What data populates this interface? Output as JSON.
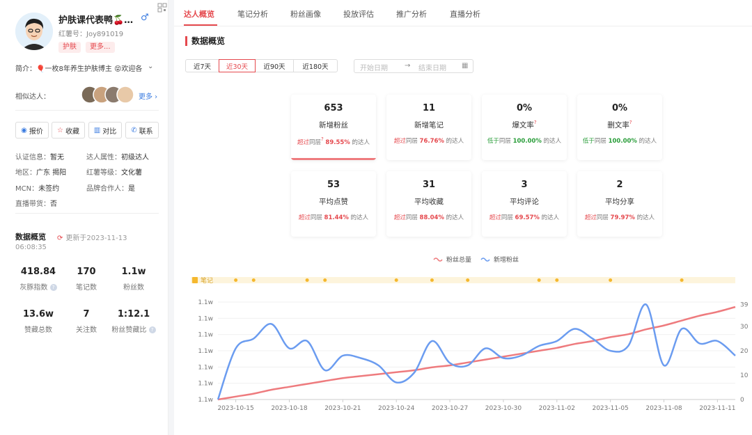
{
  "profile": {
    "name": "护肤课代表鸭🍒…",
    "gender_symbol": "♂",
    "red_id": "红薯号：Joy891019",
    "tags": [
      "护肤",
      "更多..."
    ],
    "intro": "简介：🎈一枚8年养生护肤博主 😝欢迎各",
    "similar_label": "相似达人：",
    "more_label": "更多",
    "actions": [
      "报价",
      "收藏",
      "对比",
      "联系"
    ],
    "info": {
      "cert_k": "认证信息：",
      "cert_v": "暂无",
      "attr_k": "达人属性：",
      "attr_v": "初级达人",
      "region_k": "地区：",
      "region_v": "广东 揭阳",
      "level_k": "红薯等级：",
      "level_v": "文化薯",
      "mcn_k": "MCN：",
      "mcn_v": "未签约",
      "brand_k": "品牌合作人：",
      "brand_v": "是",
      "live_k": "直播带货：",
      "live_v": "否"
    },
    "overview_title": "数据概览",
    "updated_line1": "更新于2023-11-13",
    "updated_line2": "06:08:35",
    "stats": [
      {
        "value": "418.84",
        "label": "灰豚指数"
      },
      {
        "value": "170",
        "label": "笔记数"
      },
      {
        "value": "1.1w",
        "label": "粉丝数"
      },
      {
        "value": "13.6w",
        "label": "赞藏总数"
      },
      {
        "value": "7",
        "label": "关注数"
      },
      {
        "value": "1:12.1",
        "label": "粉丝赞藏比"
      }
    ]
  },
  "tabs": [
    "达人概览",
    "笔记分析",
    "粉丝画像",
    "投放评估",
    "推广分析",
    "直播分析"
  ],
  "section_title": "数据概览",
  "ranges": [
    "近7天",
    "近30天",
    "近90天",
    "近180天"
  ],
  "selected_range": "近30天",
  "date_range": {
    "start_placeholder": "开始日期",
    "arrow": "→",
    "end_placeholder": "结束日期"
  },
  "cards": [
    {
      "value": "653",
      "label": "新增粉丝",
      "pre": "超过",
      "mid": "同层",
      "pct": "89.55%",
      "post": "的达人",
      "tone": "red",
      "help": true
    },
    {
      "value": "11",
      "label": "新增笔记",
      "pre": "超过",
      "mid": "同层",
      "pct": "76.76%",
      "post": "的达人",
      "tone": "red",
      "help": false
    },
    {
      "value": "0%",
      "label": "爆文率",
      "pre": "低于",
      "mid": "同层",
      "pct": "100.00%",
      "post": "的达人",
      "tone": "green",
      "help": true
    },
    {
      "value": "0%",
      "label": "删文率",
      "pre": "低于",
      "mid": "同层",
      "pct": "100.00%",
      "post": "的达人",
      "tone": "green",
      "help": true
    },
    {
      "value": "53",
      "label": "平均点赞",
      "pre": "超过",
      "mid": "同层",
      "pct": "81.44%",
      "post": "的达人",
      "tone": "red",
      "help": false
    },
    {
      "value": "31",
      "label": "平均收藏",
      "pre": "超过",
      "mid": "同层",
      "pct": "88.04%",
      "post": "的达人",
      "tone": "red",
      "help": false
    },
    {
      "value": "3",
      "label": "平均评论",
      "pre": "超过",
      "mid": "同层",
      "pct": "69.57%",
      "post": "的达人",
      "tone": "red",
      "help": false
    },
    {
      "value": "2",
      "label": "平均分享",
      "pre": "超过",
      "mid": "同层",
      "pct": "79.97%",
      "post": "的达人",
      "tone": "red",
      "help": false
    }
  ],
  "legend": {
    "total": "粉丝总量",
    "new": "新增粉丝"
  },
  "colors": {
    "accent": "#e5484d",
    "total_line": "#ee7b7e",
    "new_line": "#6b9cf0",
    "note_dot": "#f5b82e",
    "green": "#2a9d3a"
  },
  "chart_data": {
    "type": "line",
    "note_label": "笔记",
    "x": [
      "2023-10-14",
      "2023-10-15",
      "2023-10-16",
      "2023-10-17",
      "2023-10-18",
      "2023-10-19",
      "2023-10-20",
      "2023-10-21",
      "2023-10-22",
      "2023-10-23",
      "2023-10-24",
      "2023-10-25",
      "2023-10-26",
      "2023-10-27",
      "2023-10-28",
      "2023-10-29",
      "2023-10-30",
      "2023-10-31",
      "2023-11-01",
      "2023-11-02",
      "2023-11-03",
      "2023-11-04",
      "2023-11-05",
      "2023-11-06",
      "2023-11-07",
      "2023-11-08",
      "2023-11-09",
      "2023-11-10",
      "2023-11-11",
      "2023-11-12"
    ],
    "x_tick_labels": [
      "2023-10-15",
      "2023-10-18",
      "2023-10-21",
      "2023-10-24",
      "2023-10-27",
      "2023-10-30",
      "2023-11-02",
      "2023-11-05",
      "2023-11-08",
      "2023-11-11"
    ],
    "left_axis_labels": [
      "1.1w",
      "1.1w",
      "1.1w",
      "1.1w",
      "1.1w",
      "1.1w",
      "1.1w"
    ],
    "right_axis": {
      "ylim": [
        0,
        40
      ],
      "ticks": [
        0,
        10,
        20,
        30,
        39
      ]
    },
    "series": [
      {
        "name": "新增粉丝",
        "axis": "right",
        "values": [
          0,
          21,
          25,
          31,
          21,
          24,
          12,
          18,
          17,
          14,
          7,
          11,
          24,
          15,
          14,
          21,
          17,
          18,
          22,
          24,
          29,
          25,
          20,
          22,
          39,
          14,
          29,
          23,
          24,
          18
        ]
      },
      {
        "name": "粉丝总量",
        "axis": "left",
        "values": [
          0.0,
          0.03,
          0.06,
          0.1,
          0.13,
          0.16,
          0.19,
          0.22,
          0.24,
          0.26,
          0.28,
          0.3,
          0.33,
          0.35,
          0.38,
          0.41,
          0.44,
          0.47,
          0.5,
          0.53,
          0.57,
          0.6,
          0.64,
          0.67,
          0.72,
          0.76,
          0.81,
          0.86,
          0.9,
          0.95
        ]
      }
    ],
    "note_dates": [
      "2023-10-15",
      "2023-10-16",
      "2023-10-19",
      "2023-10-20",
      "2023-10-24",
      "2023-10-26",
      "2023-10-28",
      "2023-11-01",
      "2023-11-02",
      "2023-11-05",
      "2023-11-09"
    ]
  }
}
